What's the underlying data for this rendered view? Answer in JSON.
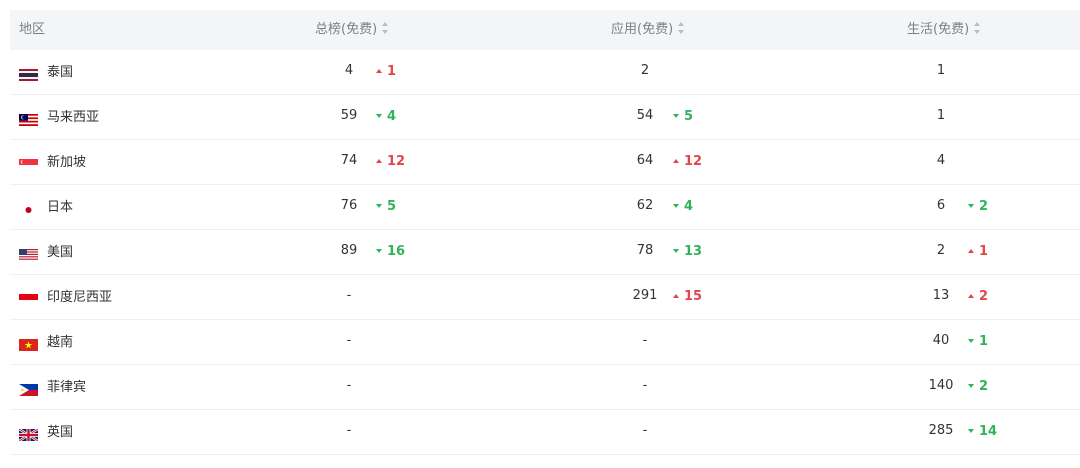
{
  "header": {
    "region": "地区",
    "col1": "总榜(免费)",
    "col2": "应用(免费)",
    "col3": "生活(免费)"
  },
  "colors": {
    "up": "#e0474c",
    "down": "#2fb45a",
    "header_bg": "#f4f5f7"
  },
  "rows": [
    {
      "region": "泰国",
      "flag": "thailand-flag-icon",
      "c1": {
        "rank": "4",
        "change": "1",
        "dir": "up"
      },
      "c2": {
        "rank": "2",
        "change": "",
        "dir": ""
      },
      "c3": {
        "rank": "1",
        "change": "",
        "dir": ""
      }
    },
    {
      "region": "马来西亚",
      "flag": "malaysia-flag-icon",
      "c1": {
        "rank": "59",
        "change": "4",
        "dir": "down"
      },
      "c2": {
        "rank": "54",
        "change": "5",
        "dir": "down"
      },
      "c3": {
        "rank": "1",
        "change": "",
        "dir": ""
      }
    },
    {
      "region": "新加坡",
      "flag": "singapore-flag-icon",
      "c1": {
        "rank": "74",
        "change": "12",
        "dir": "up"
      },
      "c2": {
        "rank": "64",
        "change": "12",
        "dir": "up"
      },
      "c3": {
        "rank": "4",
        "change": "",
        "dir": ""
      }
    },
    {
      "region": "日本",
      "flag": "japan-flag-icon",
      "c1": {
        "rank": "76",
        "change": "5",
        "dir": "down"
      },
      "c2": {
        "rank": "62",
        "change": "4",
        "dir": "down"
      },
      "c3": {
        "rank": "6",
        "change": "2",
        "dir": "down"
      }
    },
    {
      "region": "美国",
      "flag": "usa-flag-icon",
      "c1": {
        "rank": "89",
        "change": "16",
        "dir": "down"
      },
      "c2": {
        "rank": "78",
        "change": "13",
        "dir": "down"
      },
      "c3": {
        "rank": "2",
        "change": "1",
        "dir": "up"
      }
    },
    {
      "region": "印度尼西亚",
      "flag": "indonesia-flag-icon",
      "c1": {
        "rank": "-",
        "change": "",
        "dir": ""
      },
      "c2": {
        "rank": "291",
        "change": "15",
        "dir": "up"
      },
      "c3": {
        "rank": "13",
        "change": "2",
        "dir": "up"
      }
    },
    {
      "region": "越南",
      "flag": "vietnam-flag-icon",
      "c1": {
        "rank": "-",
        "change": "",
        "dir": ""
      },
      "c2": {
        "rank": "-",
        "change": "",
        "dir": ""
      },
      "c3": {
        "rank": "40",
        "change": "1",
        "dir": "down"
      }
    },
    {
      "region": "菲律宾",
      "flag": "philippines-flag-icon",
      "c1": {
        "rank": "-",
        "change": "",
        "dir": ""
      },
      "c2": {
        "rank": "-",
        "change": "",
        "dir": ""
      },
      "c3": {
        "rank": "140",
        "change": "2",
        "dir": "down"
      }
    },
    {
      "region": "英国",
      "flag": "uk-flag-icon",
      "c1": {
        "rank": "-",
        "change": "",
        "dir": ""
      },
      "c2": {
        "rank": "-",
        "change": "",
        "dir": ""
      },
      "c3": {
        "rank": "285",
        "change": "14",
        "dir": "down"
      }
    }
  ]
}
